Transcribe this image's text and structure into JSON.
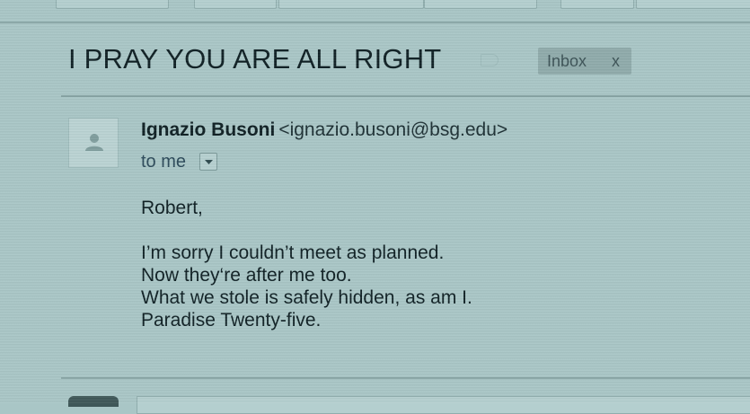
{
  "email": {
    "subject": "I PRAY YOU ARE ALL RIGHT",
    "label": {
      "text": "Inbox",
      "remove": "x"
    },
    "sender": {
      "name": "Ignazio Busoni",
      "email": "<ignazio.busoni@bsg.edu>"
    },
    "recipient": "to me",
    "body": {
      "greeting": "Robert,",
      "lines": [
        "I’m sorry I couldn’t meet as planned.",
        "Now they‘re after me too.",
        "What we stole is safely hidden, as am I.",
        "Paradise Twenty-five."
      ]
    }
  },
  "icons": {
    "avatar": "person-icon",
    "label": "label-tag-icon",
    "dropdown": "chevron-down-icon"
  }
}
